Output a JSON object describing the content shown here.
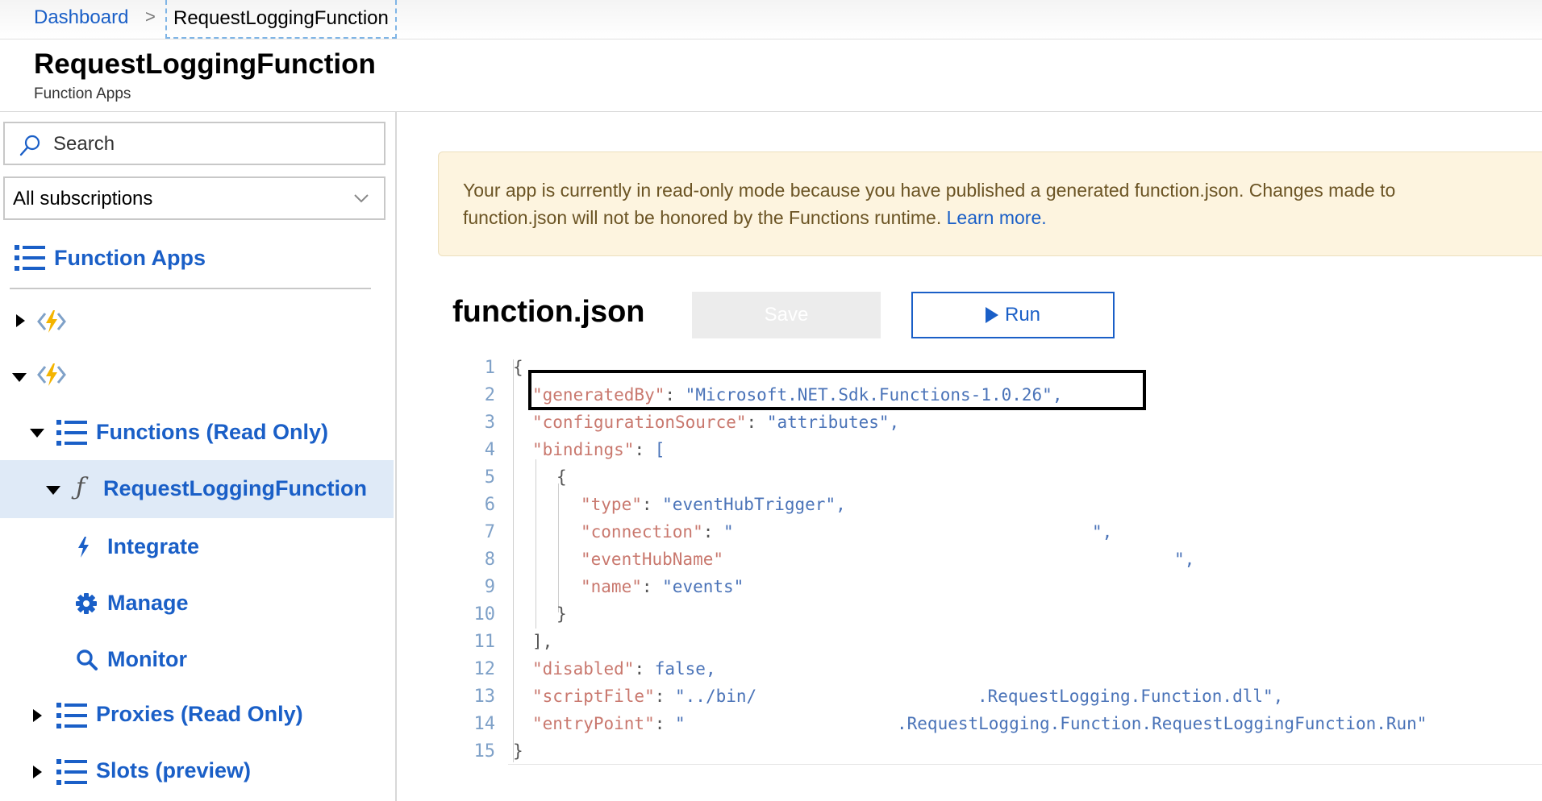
{
  "breadcrumb": {
    "dashboard": "Dashboard",
    "separator": ">",
    "current": "RequestLoggingFunction"
  },
  "header": {
    "title": "RequestLoggingFunction",
    "subtitle": "Function Apps"
  },
  "sidebar": {
    "search_placeholder": "Search",
    "subscription_select": "All subscriptions",
    "function_apps_label": "Function Apps",
    "functions_label": "Functions (Read Only)",
    "function_name": "RequestLoggingFunction",
    "integrate_label": "Integrate",
    "manage_label": "Manage",
    "monitor_label": "Monitor",
    "proxies_label": "Proxies (Read Only)",
    "slots_label": "Slots (preview)"
  },
  "banner": {
    "message": "Your app is currently in read-only mode because you have published a generated function.json. Changes made to function.json will not be honored by the Functions runtime.",
    "link": "Learn more."
  },
  "editor": {
    "file_name": "function.json",
    "save_label": "Save",
    "run_label": "Run",
    "line_numbers": [
      "1",
      "2",
      "3",
      "4",
      "5",
      "6",
      "7",
      "8",
      "9",
      "10",
      "11",
      "12",
      "13",
      "14",
      "15"
    ],
    "lines": [
      "{",
      "\"generatedBy\": \"Microsoft.NET.Sdk.Functions-1.0.26\",",
      "\"configurationSource\": \"attributes\",",
      "\"bindings\": [",
      "{",
      "\"type\": \"eventHubTrigger\",",
      "\"connection\": \"",
      "\"eventHubName\"",
      "\"name\": \"events\"",
      "}",
      "],",
      "\"disabled\": false,",
      "\"scriptFile\": \"../bin/",
      "\"entryPoint\": \"",
      "}"
    ],
    "line7_tail": "\",",
    "line8_tail": "\",",
    "line13_tail": ".RequestLogging.Function.dll\",",
    "line14_tail": ".RequestLogging.Function.RequestLoggingFunction.Run\""
  },
  "colors": {
    "link_blue": "#1a5fc7",
    "json_key": "#c9786e",
    "json_value": "#4a73b8",
    "banner_bg": "#fdf4df",
    "selected_bg": "#dfeaf7"
  }
}
